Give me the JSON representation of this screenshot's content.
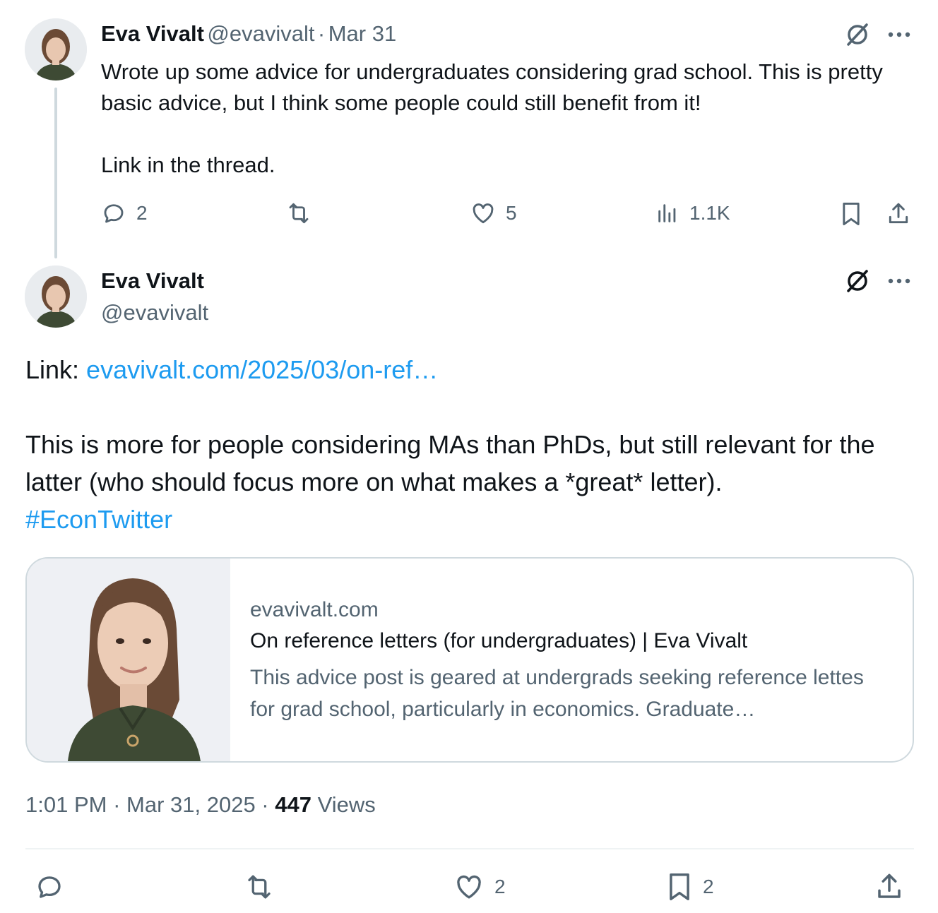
{
  "tweet1": {
    "author_name": "Eva Vivalt",
    "author_handle": "@evavivalt",
    "separator": "·",
    "date": "Mar 31",
    "text_line1": "Wrote up some advice for undergraduates considering grad school. This is pretty basic advice, but I think some people could still benefit from it!",
    "text_line2": "Link in the thread.",
    "replies": "2",
    "likes": "5",
    "views": "1.1K"
  },
  "tweet2": {
    "author_name": "Eva Vivalt",
    "author_handle": "@evavivalt",
    "link_prefix": "Link: ",
    "link_text": "evavivalt.com/2025/03/on-ref…",
    "body": "This is more for people considering MAs than PhDs, but still relevant for the latter (who should focus more on what makes a *great* letter).",
    "hashtag": "#EconTwitter",
    "card": {
      "domain": "evavivalt.com",
      "title": "On reference letters (for undergraduates) | Eva Vivalt",
      "description": "This advice post is geared at undergrads seeking reference lettes for grad school, particularly in economics. Graduate…"
    },
    "time": "1:01 PM",
    "sep1": " · ",
    "date": "Mar 31, 2025",
    "sep2": " · ",
    "views_count": "447",
    "views_label": " Views",
    "likes": "2",
    "bookmarks": "2"
  },
  "icons": {
    "reply": "reply-icon",
    "retweet": "retweet-icon",
    "like": "heart-icon",
    "views": "analytics-icon",
    "bookmark": "bookmark-icon",
    "share": "share-icon",
    "grok": "grok-icon",
    "more": "more-icon"
  },
  "colors": {
    "text": "#0f1419",
    "secondary": "#536471",
    "link": "#1d9bf0",
    "border": "#cfd9de"
  }
}
